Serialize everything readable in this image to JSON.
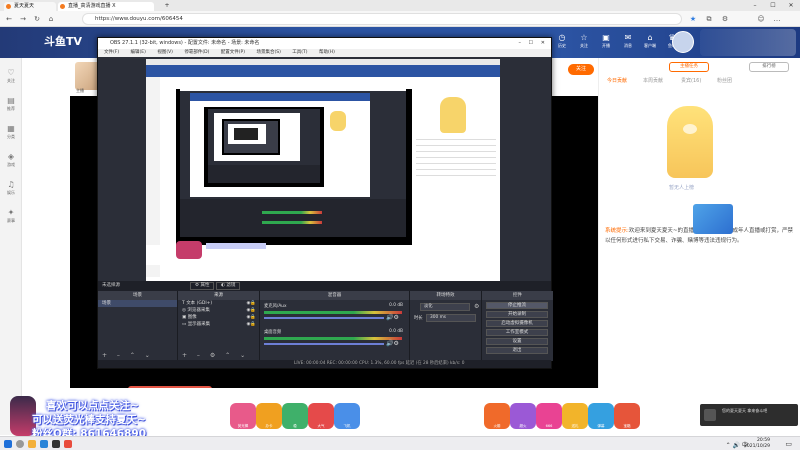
{
  "browser": {
    "tabs": [
      {
        "label": "夏天夏天"
      },
      {
        "label": "直播_高清游戏直播 X"
      }
    ],
    "url": "https://www.douyu.com/606454"
  },
  "douyu": {
    "logo": "斗鱼TV",
    "header_icons": [
      {
        "glyph": "◷",
        "label": "历史"
      },
      {
        "glyph": "☆",
        "label": "关注"
      },
      {
        "glyph": "▣",
        "label": "开播"
      },
      {
        "glyph": "✉",
        "label": "消息"
      },
      {
        "glyph": "⌂",
        "label": "客户端"
      },
      {
        "glyph": "♛",
        "label": "鱼吧"
      }
    ],
    "left_sidebar": [
      {
        "glyph": "♡",
        "label": "关注"
      },
      {
        "glyph": "▤",
        "label": "推荐"
      },
      {
        "glyph": "▦",
        "label": "分类"
      },
      {
        "glyph": "◈",
        "label": "游戏"
      },
      {
        "glyph": "♫",
        "label": "娱乐"
      },
      {
        "glyph": "✦",
        "label": "赛事"
      }
    ],
    "follow_button": "关注",
    "streamer_name": "主播"
  },
  "right_panel": {
    "tabs": [
      "今日贡献",
      "本周贡献",
      "贵宾(16)",
      "粉丝团"
    ],
    "system_msg_label": "系统提示:",
    "system_msg": "欢迎来到夏天夏天~的直播间。斗鱼禁止未成年人直播或打赏，严禁以任何形式进行私下交易、诈骗、赌博等违法违规行为。"
  },
  "obs": {
    "title": "OBS 27.1.1 (32-bit, windows) - 配置文件: 未命名 - 场景: 未命名",
    "menu": [
      "文件(F)",
      "编辑(E)",
      "视图(V)",
      "停靠部件(D)",
      "配置文件(P)",
      "场景集合(S)",
      "工具(T)",
      "帮助(H)"
    ],
    "strip": "未选择源",
    "strip_buttons": [
      "属性",
      "滤镜"
    ],
    "docks": {
      "scenes": {
        "title": "场景",
        "items": [
          "场景"
        ]
      },
      "sources": {
        "title": "来源",
        "items": [
          "文本 (GDI+)",
          "浏览器采集",
          "图像",
          "显示器采集"
        ]
      },
      "mixer": {
        "title": "混音器",
        "channels": [
          {
            "name": "麦克风/Aux",
            "level": "0.0 dB"
          },
          {
            "name": "桌面音频",
            "level": "0.0 dB"
          }
        ]
      },
      "transitions": {
        "title": "转场特效",
        "type": "淡化",
        "duration_label": "时长",
        "duration": "300 ms"
      },
      "controls": {
        "title": "控件",
        "buttons": [
          "停止推流",
          "开始录制",
          "启动虚拟摄像机",
          "工作室模式",
          "设置",
          "退出"
        ]
      }
    },
    "status": "LIVE: 00:00:04   REC: 00:00:00   CPU: 1.3%, 60.00 fps   延迟 (在 28 秒后结束)   kb/s: 0"
  },
  "overlay": {
    "line1": "喜欢可以点点关注~",
    "line2": "可以送荧光棒支持夏天~",
    "line3": "粉丝Q群: 861646890"
  },
  "toast": "主播正在为大家直播，可点击关注打卡~ 每天都有新内容哦",
  "popup": "您的夏天夏天 拿来奋斗吧",
  "gifts": [
    {
      "label": "荧光棒",
      "color": "#e85a8a"
    },
    {
      "label": "办卡",
      "color": "#f0a020"
    },
    {
      "label": "稳",
      "color": "#3fb06a"
    },
    {
      "label": "大气",
      "color": "#e54a4a"
    },
    {
      "label": "飞机",
      "color": "#4a8fe8"
    },
    {
      "label": "火箭",
      "color": "#f06a2a"
    },
    {
      "label": "超火",
      "color": "#9b59d6"
    },
    {
      "label": "666",
      "color": "#e94393"
    },
    {
      "label": "送礼",
      "color": "#f2b42a"
    },
    {
      "label": "弹幕",
      "color": "#35a0e0"
    },
    {
      "label": "宝箱",
      "color": "#e6553a"
    }
  ],
  "taskbar": {
    "time": "20:59",
    "date": "2021/10/29"
  },
  "colors": {
    "douyu_blue": "#2c54a3",
    "douyu_orange": "#ff6a00",
    "obs_bg": "#2b2e38"
  }
}
